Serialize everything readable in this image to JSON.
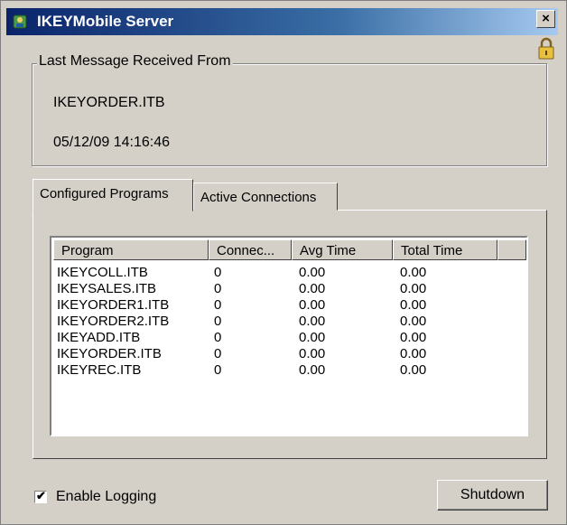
{
  "window": {
    "title": "IKEYMobile Server",
    "close_label": "×"
  },
  "last_message": {
    "legend": "Last Message Received From",
    "file": "IKEYORDER.ITB",
    "timestamp": "05/12/09 14:16:46"
  },
  "tabs": [
    {
      "label": "Configured Programs",
      "active": true
    },
    {
      "label": "Active Connections",
      "active": false
    }
  ],
  "table": {
    "columns": [
      "Program",
      "Connec...",
      "Avg Time",
      "Total Time"
    ],
    "rows": [
      [
        "IKEYCOLL.ITB",
        "0",
        "0.00",
        "0.00"
      ],
      [
        "IKEYSALES.ITB",
        "0",
        "0.00",
        "0.00"
      ],
      [
        "IKEYORDER1.ITB",
        "0",
        "0.00",
        "0.00"
      ],
      [
        "IKEYORDER2.ITB",
        "0",
        "0.00",
        "0.00"
      ],
      [
        "IKEYADD.ITB",
        "0",
        "0.00",
        "0.00"
      ],
      [
        "IKEYORDER.ITB",
        "0",
        "0.00",
        "0.00"
      ],
      [
        "IKEYREC.ITB",
        "0",
        "0.00",
        "0.00"
      ]
    ]
  },
  "logging": {
    "label": "Enable Logging",
    "checked": true,
    "checkmark": "✔"
  },
  "shutdown_label": "Shutdown",
  "colors": {
    "title_bar": "#0a246a",
    "face": "#d4d0c8"
  }
}
